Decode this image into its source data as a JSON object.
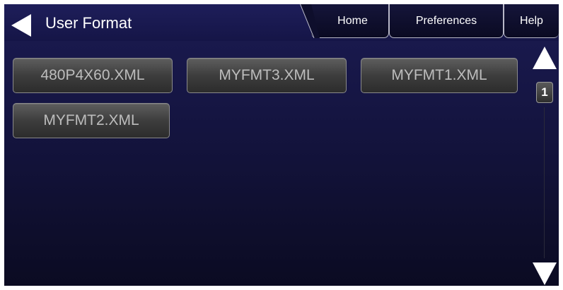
{
  "header": {
    "title": "User Format",
    "back_icon": "back-arrow-icon",
    "tabs": [
      {
        "label": "Home"
      },
      {
        "label": "Preferences"
      },
      {
        "label": "Help"
      }
    ]
  },
  "files": [
    {
      "label": "480P4X60.XML"
    },
    {
      "label": "MYFMT3.XML"
    },
    {
      "label": "MYFMT1.XML"
    },
    {
      "label": "MYFMT2.XML"
    }
  ],
  "pager": {
    "page": "1",
    "up_icon": "scroll-up-icon",
    "down_icon": "scroll-down-icon"
  },
  "colors": {
    "background": "#14143f",
    "button": "#3d3d3d",
    "button_text": "#bdbdbd",
    "header_text": "#ffffff"
  }
}
